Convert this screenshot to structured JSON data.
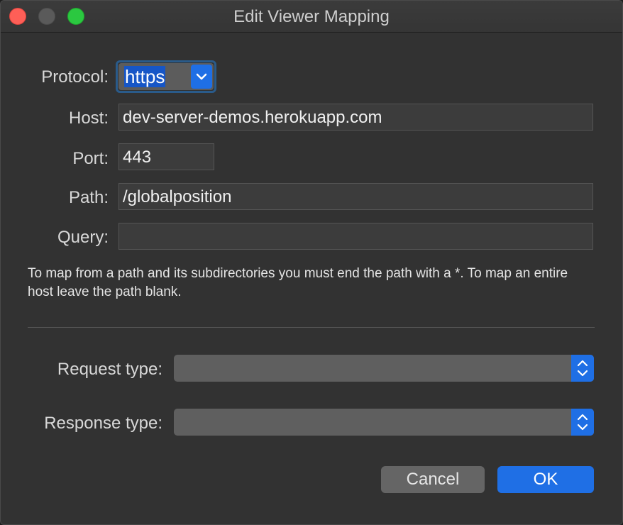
{
  "window": {
    "title": "Edit Viewer Mapping"
  },
  "form": {
    "protocol_label": "Protocol:",
    "protocol_value": "https",
    "host_label": "Host:",
    "host_value": "dev-server-demos.herokuapp.com",
    "port_label": "Port:",
    "port_value": "443",
    "path_label": "Path:",
    "path_value": "/globalposition",
    "query_label": "Query:",
    "query_value": "",
    "help_text": "To map from a path and its subdirectories you must end the path with a *. To map an entire host leave the path blank.",
    "request_type_label": "Request type:",
    "request_type_value": "",
    "response_type_label": "Response type:",
    "response_type_value": ""
  },
  "buttons": {
    "cancel": "Cancel",
    "ok": "OK"
  },
  "colors": {
    "accent": "#1f6fe5",
    "close": "#fe5f57",
    "maximize": "#2bc840"
  },
  "icons": {
    "protocol_dropdown": "chevron-down-icon",
    "combo": "up-down-chevron-icon"
  }
}
